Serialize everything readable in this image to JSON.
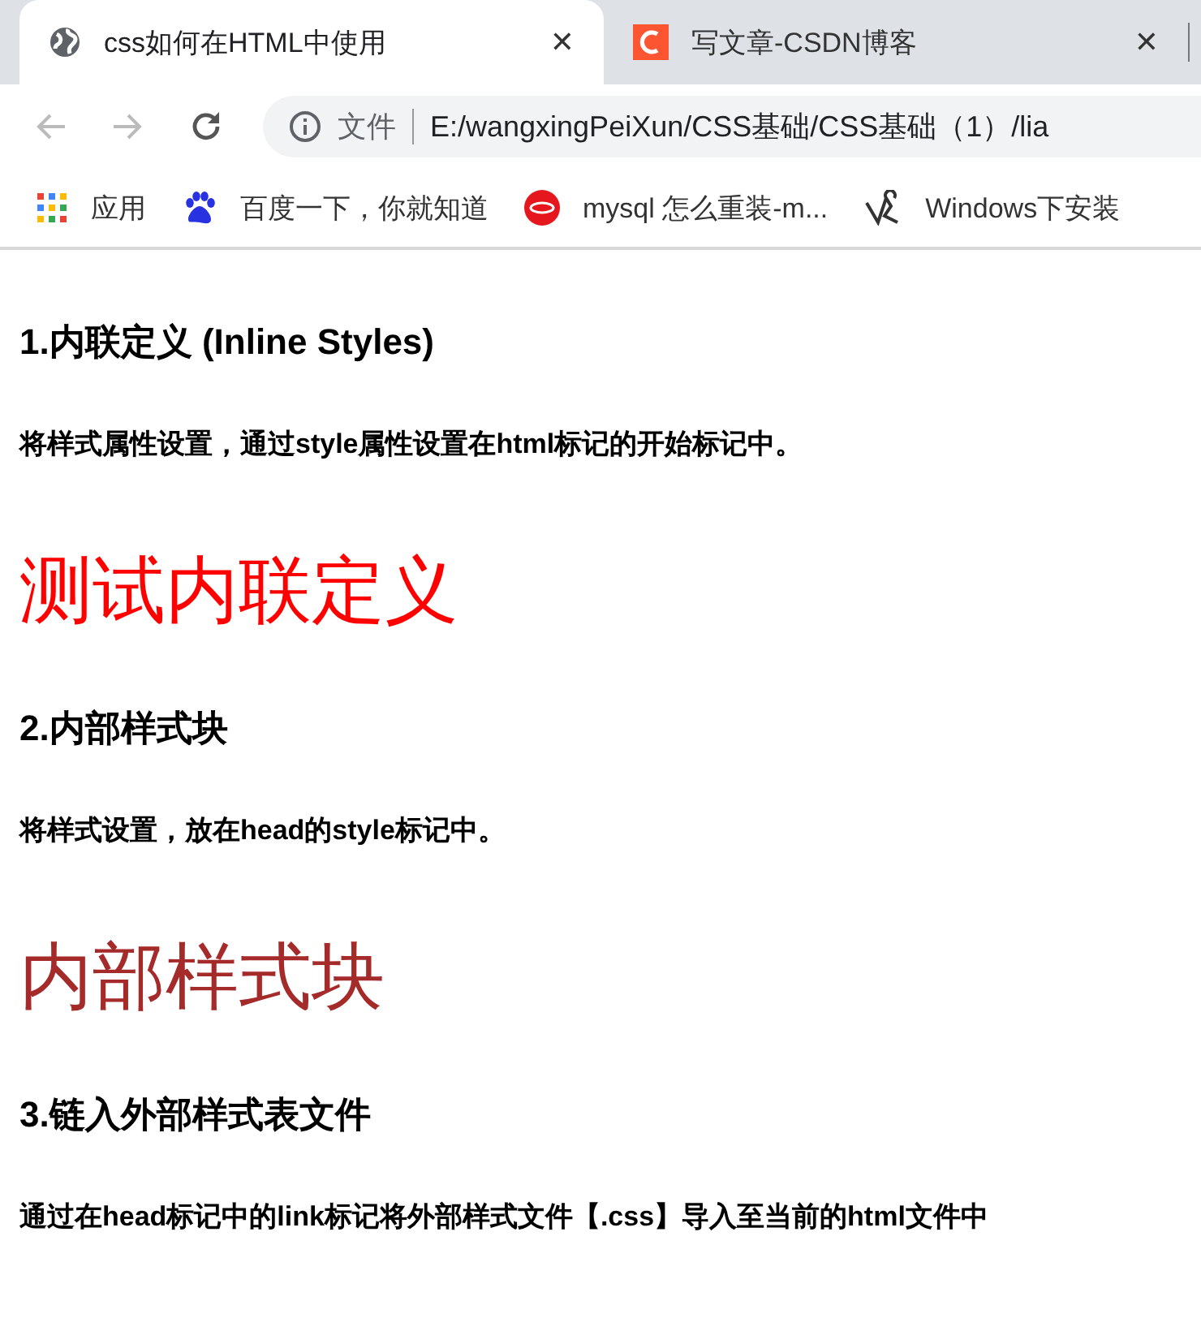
{
  "tabs": [
    {
      "title": "css如何在HTML中使用",
      "selected": true,
      "close": "✕"
    },
    {
      "title": "写文章-CSDN博客",
      "selected": false,
      "close": "✕"
    }
  ],
  "toolbar": {
    "security_label": "文件",
    "url": "E:/wangxingPeiXun/CSS基础/CSS基础（1）/lia"
  },
  "bookmarks": [
    {
      "label": "应用"
    },
    {
      "label": "百度一下，你就知道"
    },
    {
      "label": "mysql 怎么重装-m..."
    },
    {
      "label": "Windows下安装"
    }
  ],
  "content": [
    {
      "kind": "heading",
      "text": "1.内联定义 (Inline Styles)"
    },
    {
      "kind": "note",
      "text": "将样式属性设置，通过style属性设置在html标记的开始标记中。"
    },
    {
      "kind": "demo",
      "text": "测试内联定义",
      "color": "#ff0000"
    },
    {
      "kind": "heading",
      "text": "2.内部样式块"
    },
    {
      "kind": "note",
      "text": "将样式设置，放在head的style标记中。"
    },
    {
      "kind": "demo",
      "text": "内部样式块",
      "color": "#a52a2a"
    },
    {
      "kind": "heading",
      "text": "3.链入外部样式表文件"
    },
    {
      "kind": "note",
      "text": "通过在head标记中的link标记将外部样式文件【.css】导入至当前的html文件中"
    }
  ]
}
